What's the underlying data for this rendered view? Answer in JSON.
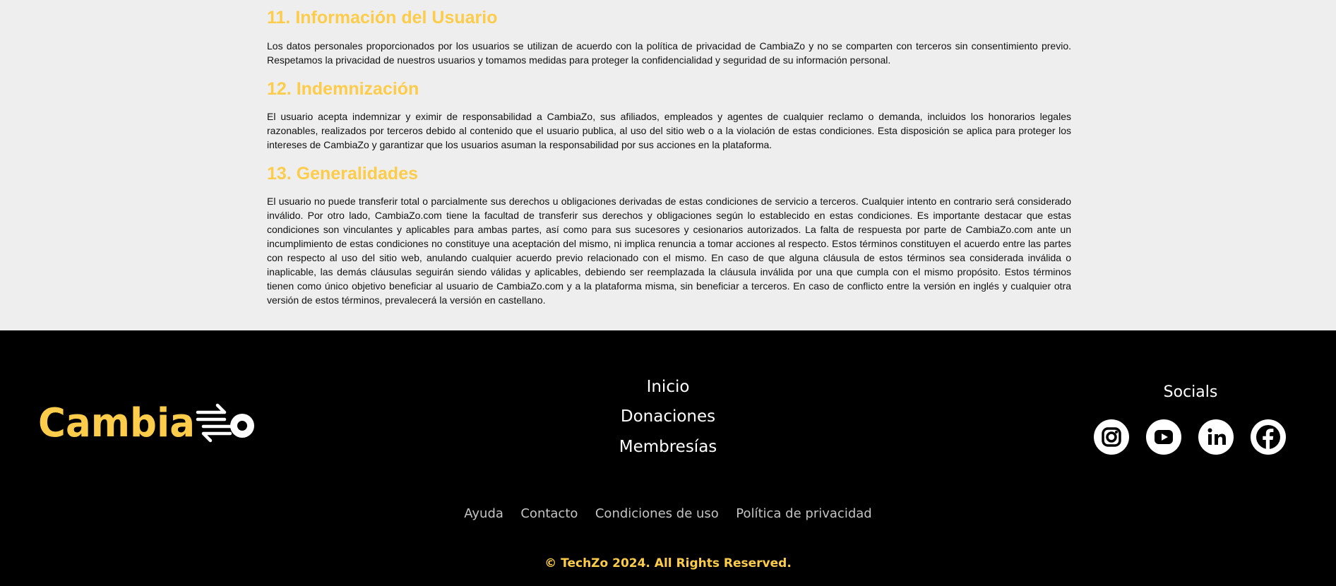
{
  "sections": [
    {
      "title": "11. Información del Usuario",
      "text": "Los datos personales proporcionados por los usuarios se utilizan de acuerdo con la política de privacidad de CambiaZo y no se comparten con terceros sin consentimiento previo. Respetamos la privacidad de nuestros usuarios y tomamos medidas para proteger la confidencialidad y seguridad de su información personal."
    },
    {
      "title": "12. Indemnización",
      "text": "El usuario acepta indemnizar y eximir de responsabilidad a CambiaZo, sus afiliados, empleados y agentes de cualquier reclamo o demanda, incluidos los honorarios legales razonables, realizados por terceros debido al contenido que el usuario publica, al uso del sitio web o a la violación de estas condiciones. Esta disposición se aplica para proteger los intereses de CambiaZo y garantizar que los usuarios asuman la responsabilidad por sus acciones en la plataforma."
    },
    {
      "title": "13. Generalidades",
      "text": "El usuario no puede transferir total o parcialmente sus derechos u obligaciones derivadas de estas condiciones de servicio a terceros. Cualquier intento en contrario será considerado inválido. Por otro lado, CambiaZo.com tiene la facultad de transferir sus derechos y obligaciones según lo establecido en estas condiciones. Es importante destacar que estas condiciones son vinculantes y aplicables para ambas partes, así como para sus sucesores y cesionarios autorizados. La falta de respuesta por parte de CambiaZo.com ante un incumplimiento de estas condiciones no constituye una aceptación del mismo, ni implica renuncia a tomar acciones al respecto. Estos términos constituyen el acuerdo entre las partes con respecto al uso del sitio web, anulando cualquier acuerdo previo relacionado con el mismo. En caso de que alguna cláusula de estos términos sea considerada inválida o inaplicable, las demás cláusulas seguirán siendo válidas y aplicables, debiendo ser reemplazada la cláusula inválida por una que cumpla con el mismo propósito. Estos términos tienen como único objetivo beneficiar al usuario de CambiaZo.com y a la plataforma misma, sin beneficiar a terceros. En caso de conflicto entre la versión en inglés y cualquier otra versión de estos términos, prevalecerá la versión en castellano."
    }
  ],
  "footer": {
    "logo_text": "CambiaZo",
    "nav": [
      "Inicio",
      "Donaciones",
      "Membresías"
    ],
    "socials_title": "Socials",
    "socials": [
      "instagram-icon",
      "youtube-icon",
      "linkedin-icon",
      "facebook-icon"
    ],
    "bottom_links": [
      "Ayuda",
      "Contacto",
      "Condiciones de uso",
      "Política de privacidad"
    ],
    "copyright": "© TechZo 2024. All Rights Reserved."
  },
  "colors": {
    "accent": "#fccc4a",
    "footer_bg": "#000000",
    "content_bg": "#eeeeee"
  }
}
